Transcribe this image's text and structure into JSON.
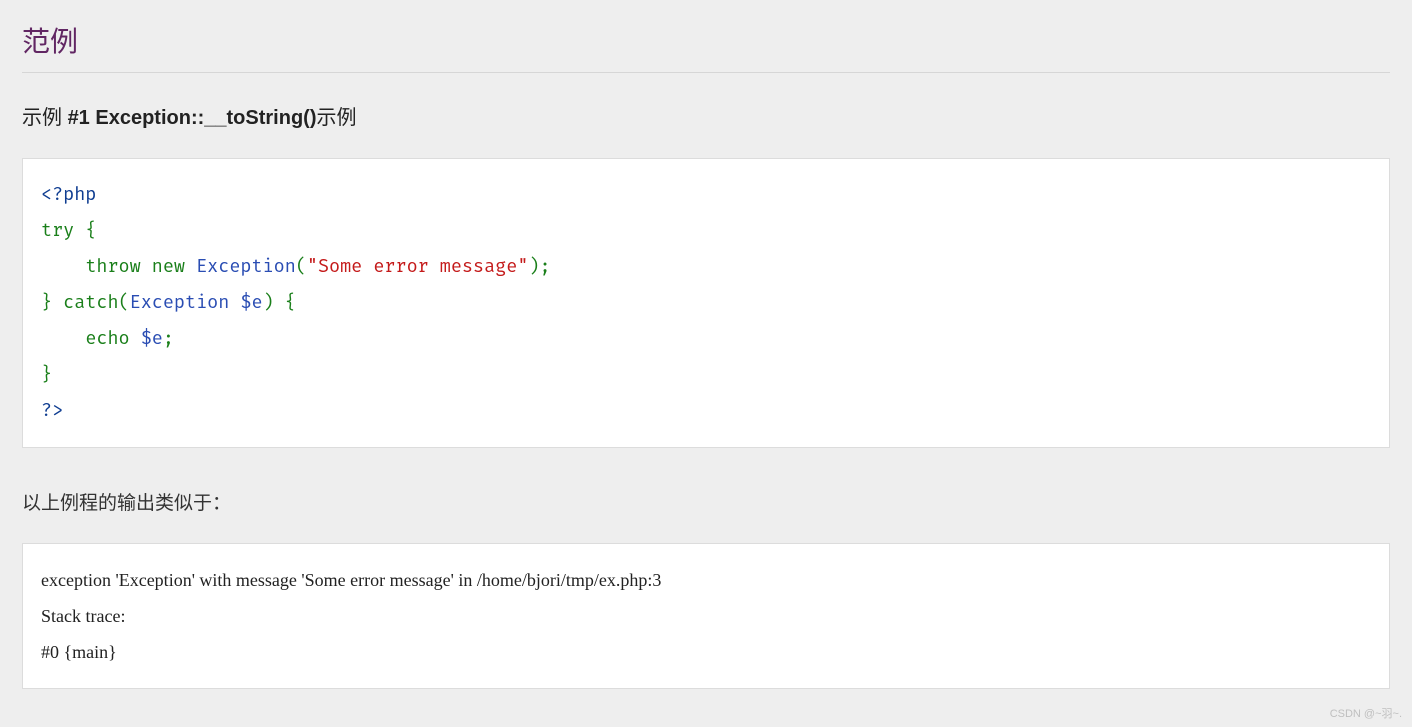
{
  "section_title": "范例",
  "example": {
    "prefix": "示例 ",
    "number_and_name": "#1 Exception::__toString()",
    "suffix": "示例"
  },
  "code": {
    "open_tag": "<?php",
    "line2": {
      "kw": "try",
      "brace": "{"
    },
    "line3": {
      "indent": "    ",
      "throw": "throw",
      "new": "new",
      "class": "Exception",
      "open_paren": "(",
      "string": "\"Some error message\"",
      "close_paren": ")",
      "semi": ";"
    },
    "line4": {
      "close_brace": "}",
      "catch": "catch",
      "open_paren": "(",
      "class": "Exception",
      "var": "$e",
      "close_paren": ")",
      "open_brace": "{"
    },
    "line5": {
      "indent": "    ",
      "echo": "echo",
      "var": "$e",
      "semi": ";"
    },
    "line6": {
      "close_brace": "}"
    },
    "close_tag": "?>"
  },
  "output_label": "以上例程的输出类似于：",
  "output_lines": {
    "l1": "exception 'Exception' with message 'Some error message' in /home/bjori/tmp/ex.php:3",
    "l2": "Stack trace:",
    "l3": "#0 {main}"
  },
  "watermark": "CSDN @~羽~."
}
